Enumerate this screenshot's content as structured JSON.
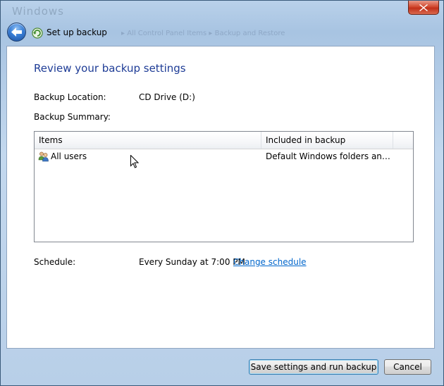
{
  "window": {
    "ghost_title": "Windows"
  },
  "nav": {
    "title": "Set up backup",
    "ghost_breadcrumb": "▸ All Control Panel Items ▸ Backup and Restore",
    "back_icon": "back-arrow-icon",
    "app_icon": "backup-icon"
  },
  "main": {
    "heading": "Review your backup settings",
    "location_label": "Backup Location:",
    "location_value": "CD Drive (D:)",
    "summary_label": "Backup Summary:",
    "table": {
      "columns": [
        "Items",
        "Included in backup"
      ],
      "rows": [
        {
          "item": "All users",
          "included": "Default Windows folders and lo..."
        }
      ]
    },
    "schedule_label": "Schedule:",
    "schedule_value": "Every Sunday at 7:00 PM",
    "change_schedule_link": "Change schedule"
  },
  "footer": {
    "save_button": "Save settings and run backup",
    "cancel_button": "Cancel"
  },
  "colors": {
    "heading": "#1e3c96",
    "link": "#0066cc",
    "close": "#c1301a"
  }
}
